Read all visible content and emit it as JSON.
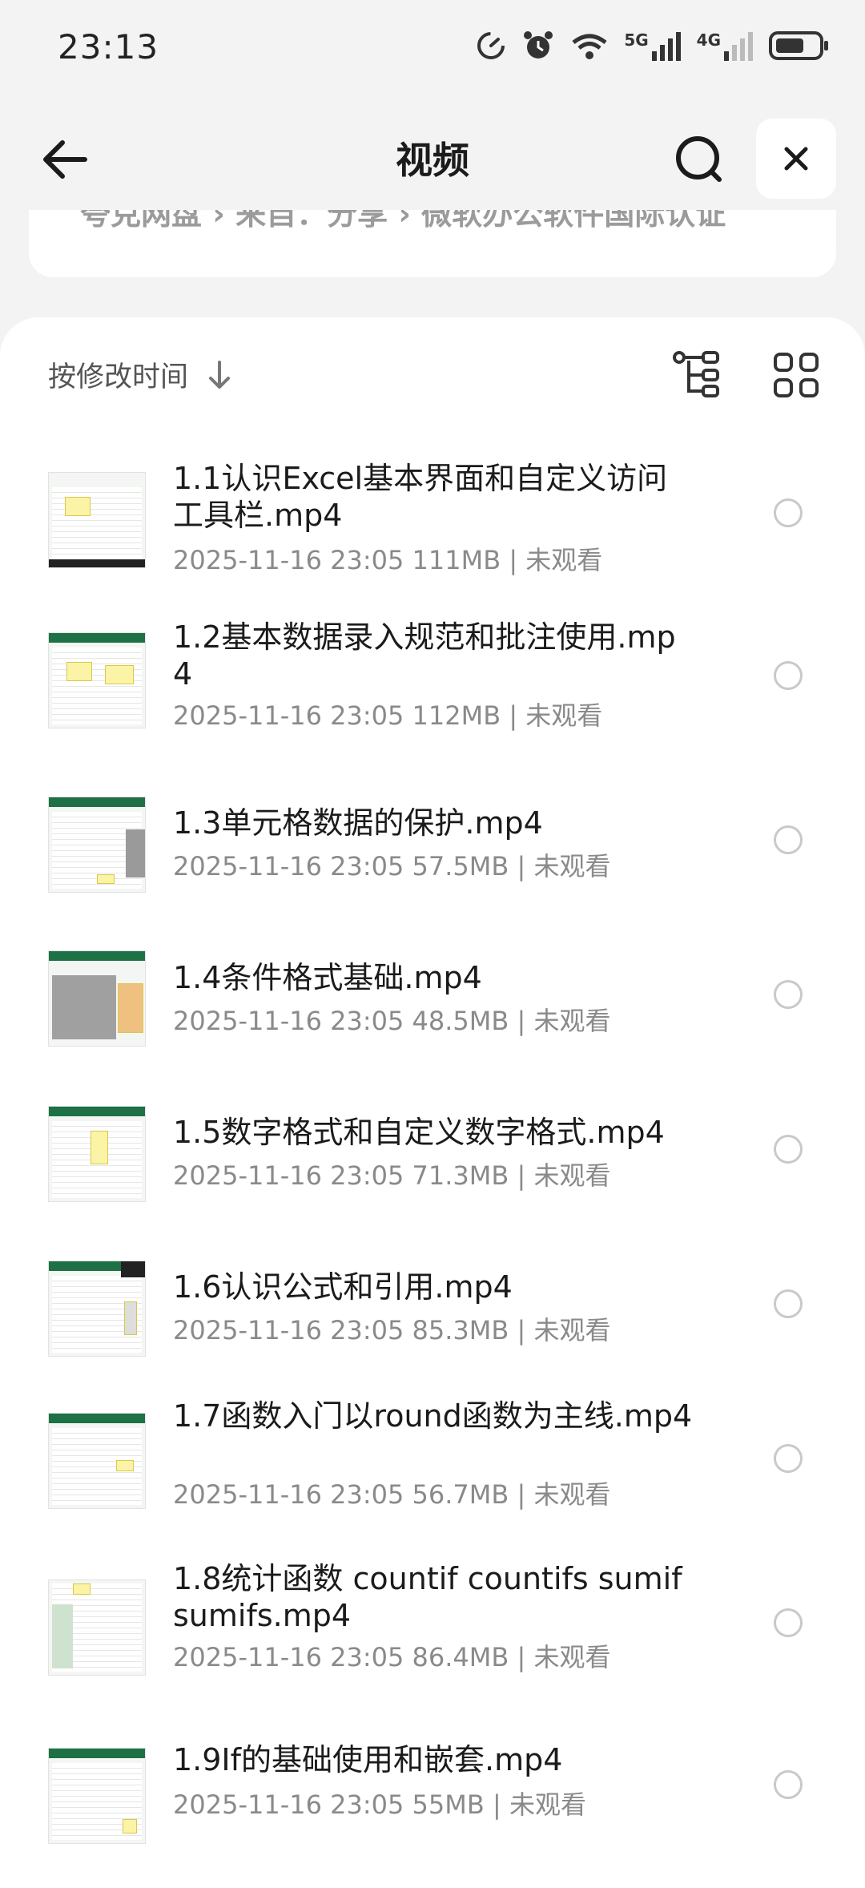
{
  "status": {
    "time": "23:13",
    "net1": "5G",
    "net2": "4G"
  },
  "header": {
    "title": "视频"
  },
  "breadcrumb": {
    "text": "夸克网盘 › 来自：分享 › 微软办公软件国际认证"
  },
  "sort": {
    "label": "按修改时间"
  },
  "files": [
    {
      "name": "1.1认识Excel基本界面和自定义访问工具栏.mp4",
      "date": "2025-11-16 23:05",
      "size": "111MB",
      "status": "未观看"
    },
    {
      "name": "1.2基本数据录入规范和批注使用.mp4",
      "date": "2025-11-16 23:05",
      "size": "112MB",
      "status": "未观看"
    },
    {
      "name": "1.3单元格数据的保护.mp4",
      "date": "2025-11-16 23:05",
      "size": "57.5MB",
      "status": "未观看"
    },
    {
      "name": "1.4条件格式基础.mp4",
      "date": "2025-11-16 23:05",
      "size": "48.5MB",
      "status": "未观看"
    },
    {
      "name": "1.5数字格式和自定义数字格式.mp4",
      "date": "2025-11-16 23:05",
      "size": "71.3MB",
      "status": "未观看"
    },
    {
      "name": "1.6认识公式和引用.mp4",
      "date": "2025-11-16 23:05",
      "size": "85.3MB",
      "status": "未观看"
    },
    {
      "name": "1.7函数入门以round函数为主线.mp4",
      "date": "2025-11-16 23:05",
      "size": "56.7MB",
      "status": "未观看"
    },
    {
      "name": "1.8统计函数 countif countifs sumif sumifs.mp4",
      "date": "2025-11-16 23:05",
      "size": "86.4MB",
      "status": "未观看"
    },
    {
      "name": "1.9If的基础使用和嵌套.mp4",
      "date": "2025-11-16 23:05",
      "size": "55MB",
      "status": "未观看"
    }
  ]
}
